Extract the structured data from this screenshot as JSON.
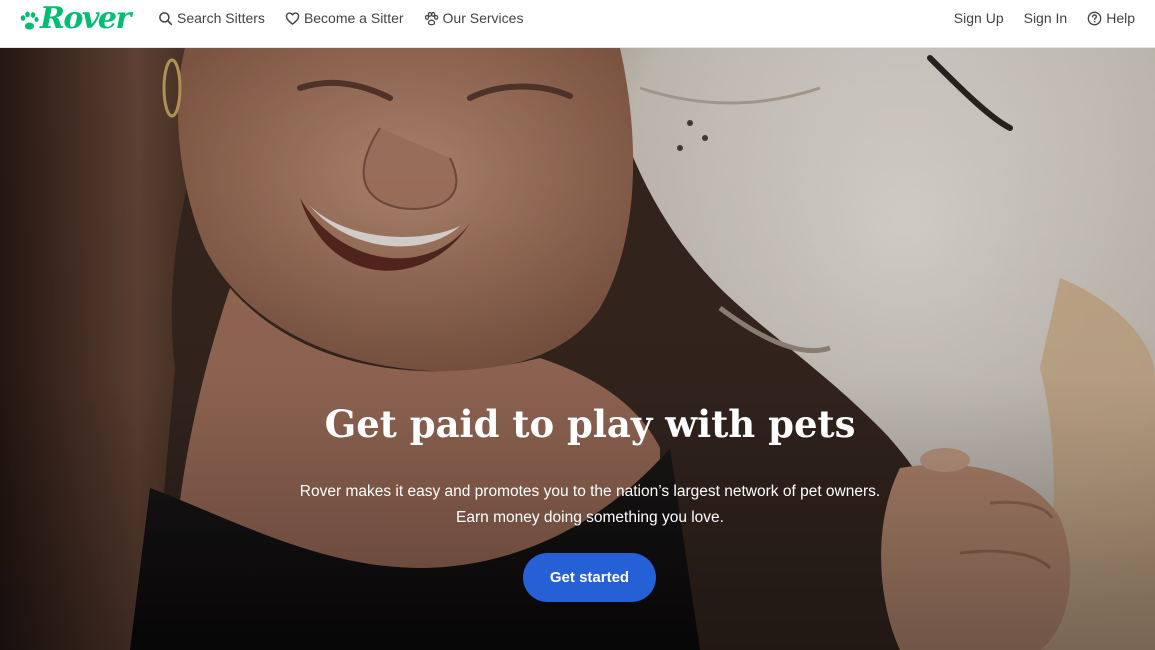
{
  "brand": {
    "name": "Rover",
    "color": "#00bd70",
    "logo_icon": "paw-icon"
  },
  "nav": {
    "left": [
      {
        "label": "Search Sitters",
        "icon": "search-icon"
      },
      {
        "label": "Become a Sitter",
        "icon": "heart-icon"
      },
      {
        "label": "Our Services",
        "icon": "paw-icon"
      }
    ],
    "right": [
      {
        "label": "Sign Up"
      },
      {
        "label": "Sign In"
      },
      {
        "label": "Help",
        "icon": "help-circle-icon"
      }
    ]
  },
  "hero": {
    "title": "Get paid to play with pets",
    "subtitle_line1": "Rover makes it easy and promotes you to the nation’s largest network of pet owners.",
    "subtitle_line2": "Earn money doing something you love.",
    "cta_label": "Get started",
    "cta_color": "#2660d6",
    "image": "Smiling woman cuddling a white dog"
  }
}
